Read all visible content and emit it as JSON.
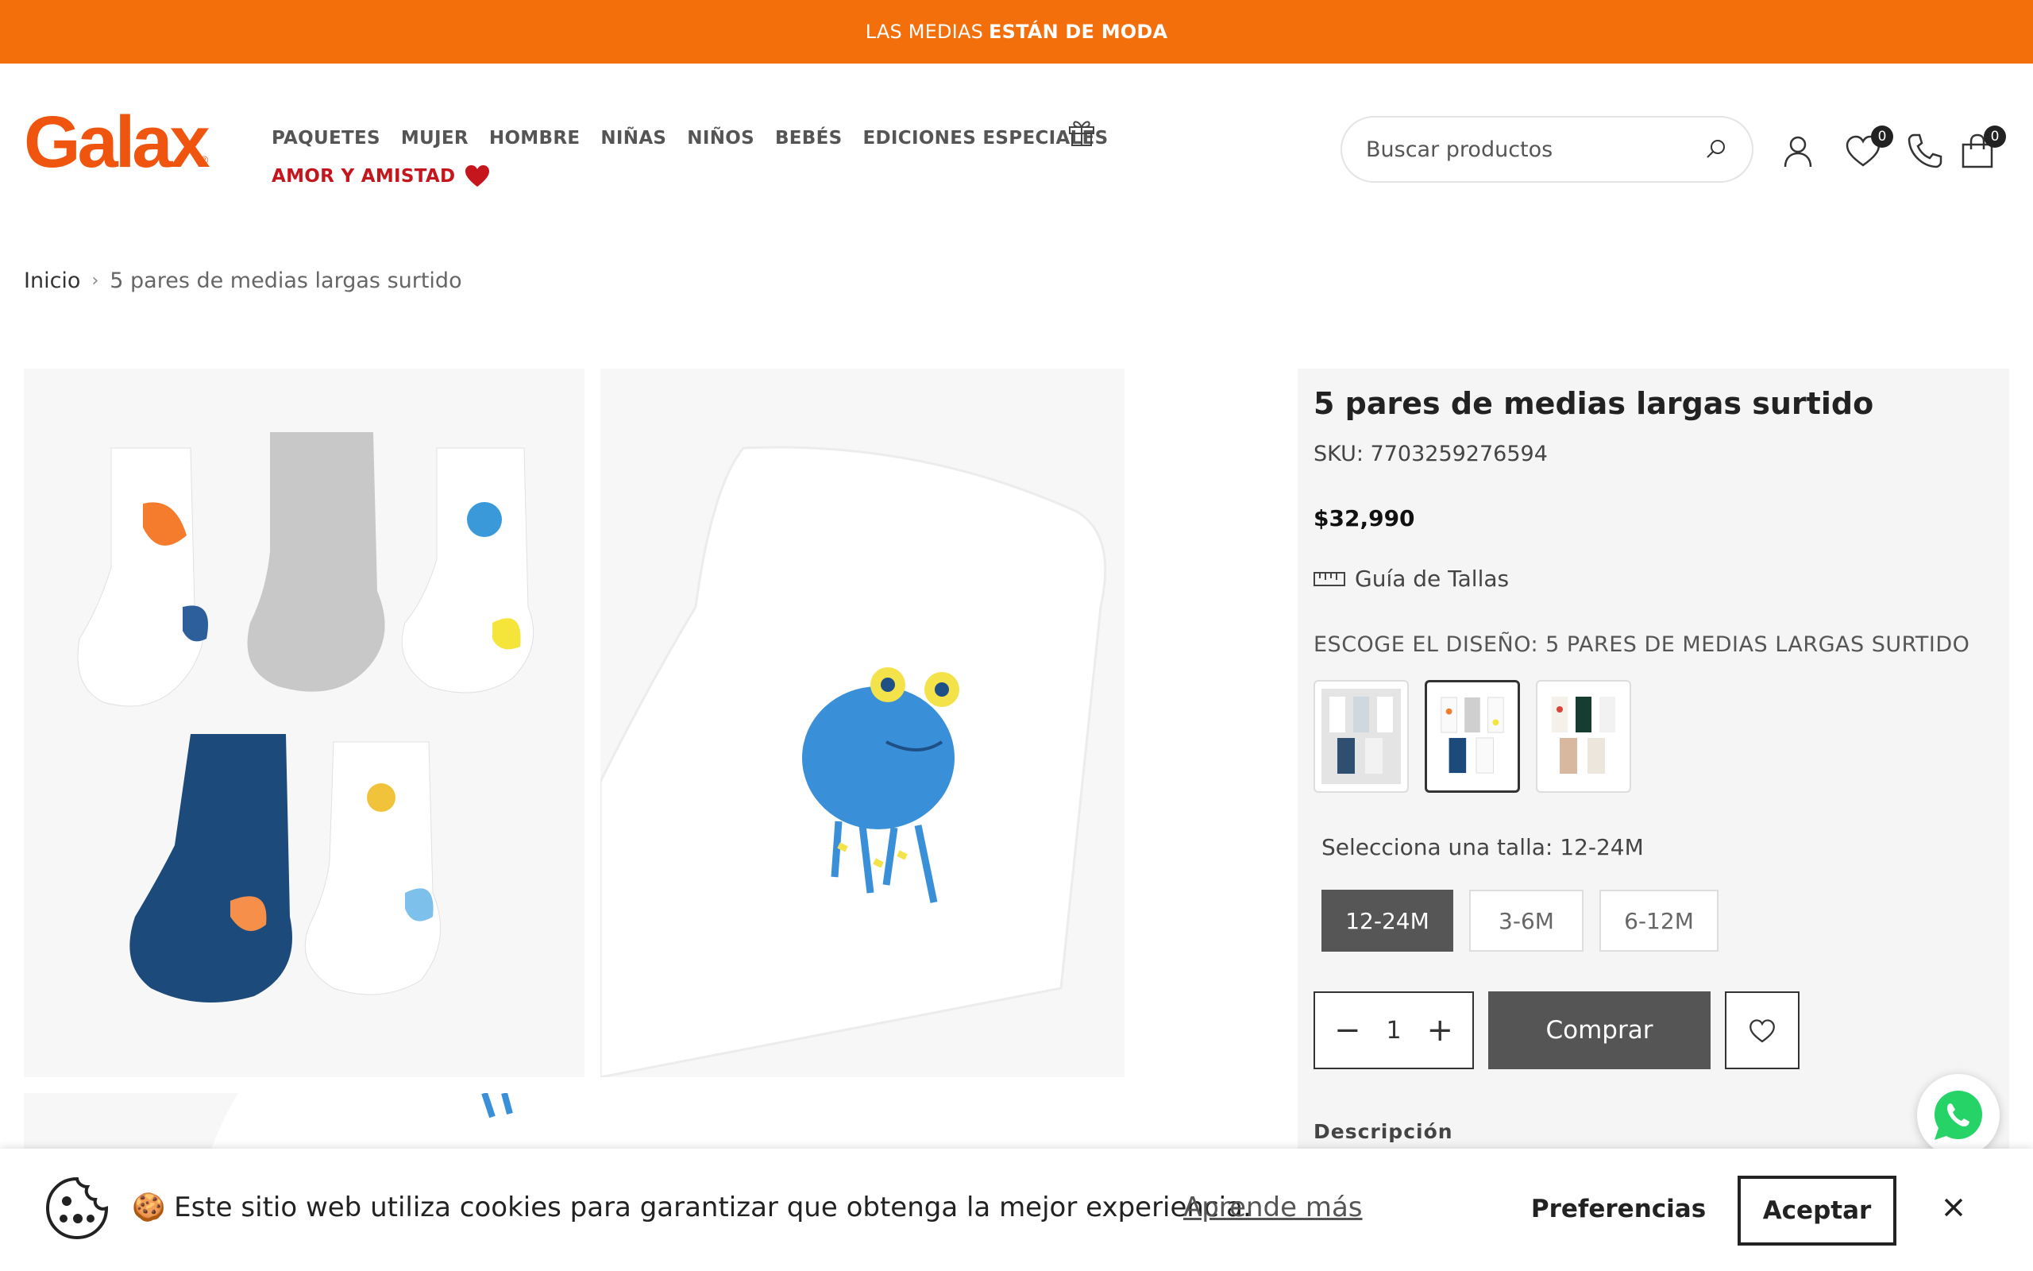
{
  "announcement": {
    "text": "LAS MEDIAS",
    "bold": "ESTÁN DE MODA"
  },
  "brand": {
    "name": "Galax",
    "registered": "®"
  },
  "nav": {
    "items": [
      "PAQUETES",
      "MUJER",
      "HOMBRE",
      "NIÑAS",
      "NIÑOS",
      "BEBÉS",
      "EDICIONES ESPECIALES"
    ],
    "special": "AMOR Y AMISTAD"
  },
  "search": {
    "placeholder": "Buscar productos"
  },
  "header": {
    "wishlist_count": "0",
    "cart_count": "0"
  },
  "breadcrumb": {
    "home": "Inicio",
    "current": "5 pares de medias largas surtido"
  },
  "product": {
    "title": "5 pares de medias largas surtido",
    "sku": "SKU: 7703259276594",
    "price": "$32,990",
    "size_guide": "Guía de Tallas",
    "design_label": "ESCOGE EL DISEÑO: 5 PARES DE MEDIAS LARGAS SURTIDO",
    "size_label": "Selecciona una talla: 12-24M",
    "sizes": [
      "12-24M",
      "3-6M",
      "6-12M"
    ],
    "selected_size": "12-24M",
    "quantity": "1",
    "buy_label": "Comprar",
    "description_heading": "Descripción"
  },
  "cookie": {
    "emoji": "🍪",
    "text": "Este sitio web utiliza cookies para garantizar que obtenga la mejor experiencia.",
    "link": "Aprende más",
    "preferences": "Preferencias",
    "accept": "Aceptar"
  },
  "colors": {
    "accent": "#f26f0c",
    "brand": "#f0550f",
    "special": "#c4161c",
    "button": "#555555"
  }
}
